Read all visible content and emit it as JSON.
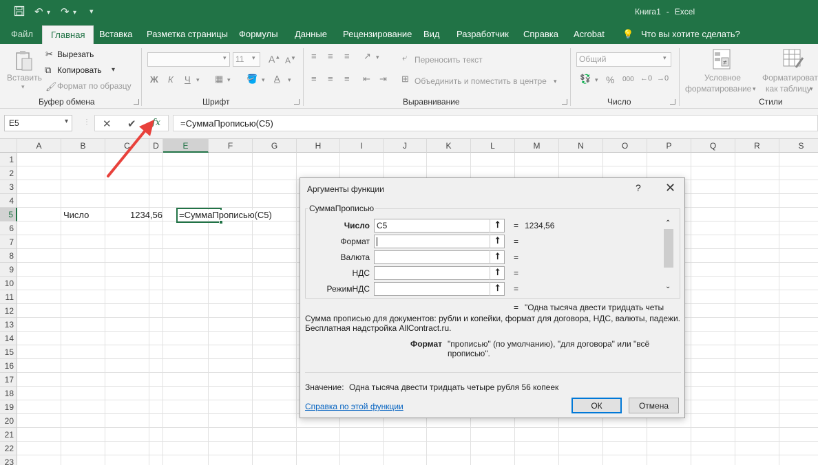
{
  "app": {
    "title": "Книга1",
    "title_sep": "-",
    "app_name": "Excel",
    "accent": "#217346"
  },
  "quick_access": {
    "save_icon": "save-icon",
    "undo_icon": "undo-icon",
    "redo_icon": "redo-icon",
    "customize_icon": "customize-icon"
  },
  "tabs": [
    "Файл",
    "Главная",
    "Вставка",
    "Разметка страницы",
    "Формулы",
    "Данные",
    "Рецензирование",
    "Вид",
    "Разработчик",
    "Справка",
    "Acrobat"
  ],
  "active_tab": "Главная",
  "tell_me": "Что вы хотите сделать?",
  "ribbon": {
    "clipboard": {
      "paste": "Вставить",
      "cut": "Вырезать",
      "copy": "Копировать",
      "format_painter": "Формат по образцу",
      "label": "Буфер обмена"
    },
    "font": {
      "font_name": "",
      "font_size": "11",
      "bold": "Ж",
      "italic": "К",
      "underline": "Ч",
      "label": "Шрифт"
    },
    "alignment": {
      "wrap_text": "Переносить текст",
      "merge_center": "Объединить и поместить в центре",
      "label": "Выравнивание"
    },
    "number": {
      "format": "Общий",
      "percent": "%",
      "thousands": "000",
      "label": "Число"
    },
    "styles": {
      "conditional_line1": "Условное",
      "conditional_line2": "форматирование",
      "table_line1": "Форматироват",
      "table_line2": "как таблицу",
      "label": "Стили"
    }
  },
  "formula_bar": {
    "name_box": "E5",
    "formula": "=СуммаПрописью(C5)",
    "fx": "fx"
  },
  "sheet": {
    "columns": [
      "A",
      "B",
      "C",
      "D",
      "E",
      "F",
      "G",
      "H",
      "I",
      "J",
      "K",
      "L",
      "M",
      "N",
      "O",
      "P",
      "Q",
      "R",
      "S"
    ],
    "rows": [
      "1",
      "2",
      "3",
      "4",
      "5",
      "6",
      "7",
      "8",
      "9",
      "10",
      "11",
      "12",
      "13",
      "14",
      "15",
      "16",
      "17",
      "18",
      "19",
      "20",
      "21",
      "22",
      "23"
    ],
    "selected_cell": "E5",
    "cells": {
      "B5": "Число",
      "C5": "1234,56",
      "E5": "=СуммаПрописью(C5)"
    }
  },
  "dialog": {
    "title": "Аргументы функции",
    "help": "?",
    "function_name": "СуммаПрописью",
    "args": [
      {
        "label": "Число",
        "value": "C5",
        "result": "1234,56"
      },
      {
        "label": "Формат",
        "value": "",
        "result": ""
      },
      {
        "label": "Валюта",
        "value": "",
        "result": ""
      },
      {
        "label": "НДС",
        "value": "",
        "result": ""
      },
      {
        "label": "РежимНДС",
        "value": "",
        "result": ""
      }
    ],
    "eq": "=",
    "result_preview": "\"Одна тысяча двести тридцать четы",
    "description_line1": "Сумма прописью для документов: рубли и копейки, формат для договора, НДС, валюты, падежи.",
    "description_line2": "Бесплатная надстройка AllContract.ru.",
    "arg_help_name": "Формат",
    "arg_help_line1": "\"прописью\" (по умолчанию), \"для договора\" или \"всё",
    "arg_help_line2": "прописью\".",
    "value_label": "Значение:",
    "value_text": "Одна тысяча двести тридцать четыре рубля 56 копеек",
    "help_link": "Справка по этой функции",
    "ok": "ОК",
    "cancel": "Отмена"
  },
  "annotation": {
    "arrow_color": "#e8413b"
  }
}
